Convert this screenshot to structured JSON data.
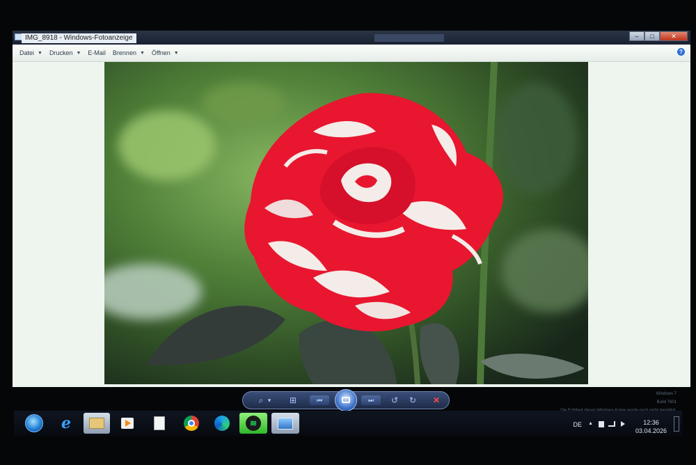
{
  "window": {
    "title": "IMG_8918 - Windows-Fotoanzeige",
    "buttons": {
      "minimize": "–",
      "maximize": "□",
      "close": "✕"
    },
    "help_icon": "?"
  },
  "menu": {
    "items": [
      {
        "label": "Datei",
        "has_caret": true
      },
      {
        "label": "Drucken",
        "has_caret": true
      },
      {
        "label": "E-Mail",
        "has_caret": false
      },
      {
        "label": "Brennen",
        "has_caret": true
      },
      {
        "label": "Öffnen",
        "has_caret": true
      }
    ],
    "caret": "▼"
  },
  "photo": {
    "subject": "red-and-white striped rose",
    "colors": {
      "petal_red": "#e8162f",
      "petal_white": "#f4ece8",
      "leaf_dark": "#2f3a34",
      "bg_green": "#4b7a36"
    }
  },
  "controls": {
    "zoom_icon": "⌕",
    "zoom_caret": "▾",
    "actual_size_icon": "⊞",
    "previous_icon": "⏮",
    "next_icon": "⏭",
    "rotate_left_icon": "↺",
    "rotate_right_icon": "↻",
    "delete_icon": "✕"
  },
  "watermark": {
    "line1": "Windows 7",
    "line2": "Build 7601",
    "line3": "Die Echtheit dieser Windows-Kopie wurde noch nicht bestätigt."
  },
  "taskbar": {
    "apps": [
      {
        "name": "start-orb"
      },
      {
        "name": "internet-explorer",
        "glyph": "e"
      },
      {
        "name": "file-explorer"
      },
      {
        "name": "media-player"
      },
      {
        "name": "document"
      },
      {
        "name": "chrome"
      },
      {
        "name": "edge"
      },
      {
        "name": "spotify",
        "glyph": "≋"
      },
      {
        "name": "photo-viewer"
      }
    ],
    "tray": {
      "language": "DE",
      "show_hidden": "▲",
      "time": "12:36",
      "date": "03.04.2026"
    }
  }
}
